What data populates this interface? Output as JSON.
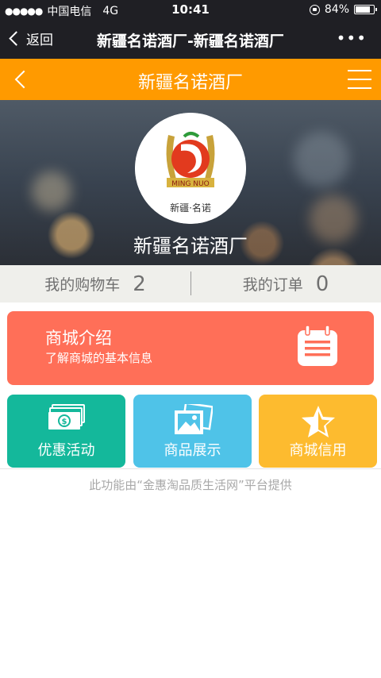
{
  "status_bar": {
    "carrier": "中国电信",
    "network": "4G",
    "time": "10:41",
    "battery": "84%",
    "battery_level": 0.84
  },
  "wechat_bar": {
    "back_label": "返回",
    "title": "新疆名诺酒厂-新疆名诺酒厂",
    "more_label": "•••"
  },
  "header": {
    "title": "新疆名诺酒厂"
  },
  "hero": {
    "store_name": "新疆名诺酒厂",
    "logo": {
      "top_text": "MING NUO",
      "bottom_text": "新疆·名诺"
    }
  },
  "stats": {
    "cart_label": "我的购物车",
    "cart_count": "2",
    "orders_label": "我的订单",
    "orders_count": "0"
  },
  "intro_card": {
    "title": "商城介绍",
    "subtitle": "了解商城的基本信息",
    "color": "#ff6f58"
  },
  "tiles": [
    {
      "label": "优惠活动",
      "icon": "money-icon",
      "color": "#14b89b"
    },
    {
      "label": "商品展示",
      "icon": "gallery-icon",
      "color": "#4fc3e8"
    },
    {
      "label": "商城信用",
      "icon": "star-icon",
      "color": "#fdbb2f"
    }
  ],
  "footer": {
    "text": "此功能由“金惠淘品质生活网”平台提供"
  },
  "colors": {
    "status_bg": "#1f1f24",
    "header_bg": "#ff9a00",
    "stats_bg": "#efefeb"
  }
}
